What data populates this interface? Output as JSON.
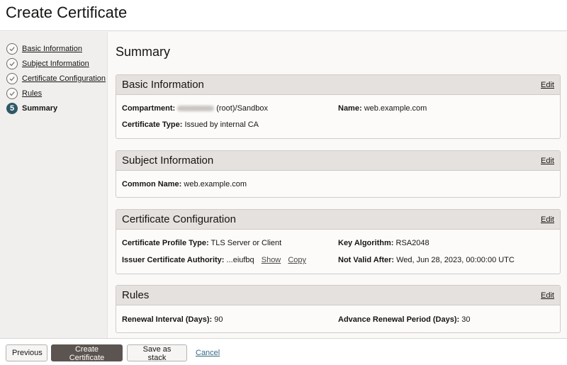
{
  "header": {
    "title": "Create Certificate"
  },
  "steps": [
    {
      "label": "Basic Information",
      "state": "done"
    },
    {
      "label": "Subject Information",
      "state": "done"
    },
    {
      "label": "Certificate Configuration",
      "state": "done"
    },
    {
      "label": "Rules",
      "state": "done"
    },
    {
      "label": "Summary",
      "state": "current",
      "number": "5"
    }
  ],
  "main": {
    "title": "Summary"
  },
  "edit_label": "Edit",
  "panels": {
    "basic": {
      "title": "Basic Information",
      "compartment_label": "Compartment:",
      "compartment_value": "(root)/Sandbox",
      "name_label": "Name:",
      "name_value": "web.example.com",
      "cert_type_label": "Certificate Type:",
      "cert_type_value": "Issued by internal CA"
    },
    "subject": {
      "title": "Subject Information",
      "common_name_label": "Common Name:",
      "common_name_value": "web.example.com"
    },
    "config": {
      "title": "Certificate Configuration",
      "profile_label": "Certificate Profile Type:",
      "profile_value": "TLS Server or Client",
      "key_alg_label": "Key Algorithm:",
      "key_alg_value": "RSA2048",
      "issuer_label": "Issuer Certificate Authority:",
      "issuer_value": "...eiufbq",
      "show_label": "Show",
      "copy_label": "Copy",
      "not_valid_label": "Not Valid After:",
      "not_valid_value": "Wed, Jun 28, 2023, 00:00:00 UTC"
    },
    "rules": {
      "title": "Rules",
      "renewal_label": "Renewal Interval (Days):",
      "renewal_value": "90",
      "advance_label": "Advance Renewal Period (Days):",
      "advance_value": "30"
    }
  },
  "footer": {
    "previous": "Previous",
    "create": "Create Certificate",
    "save_stack": "Save as stack",
    "cancel": "Cancel"
  },
  "colors": {
    "accent": "#2c5967",
    "primary_button": "#5c5450",
    "link": "#2e6b9e"
  },
  "icons": {
    "done_step": "check-circle-icon"
  }
}
